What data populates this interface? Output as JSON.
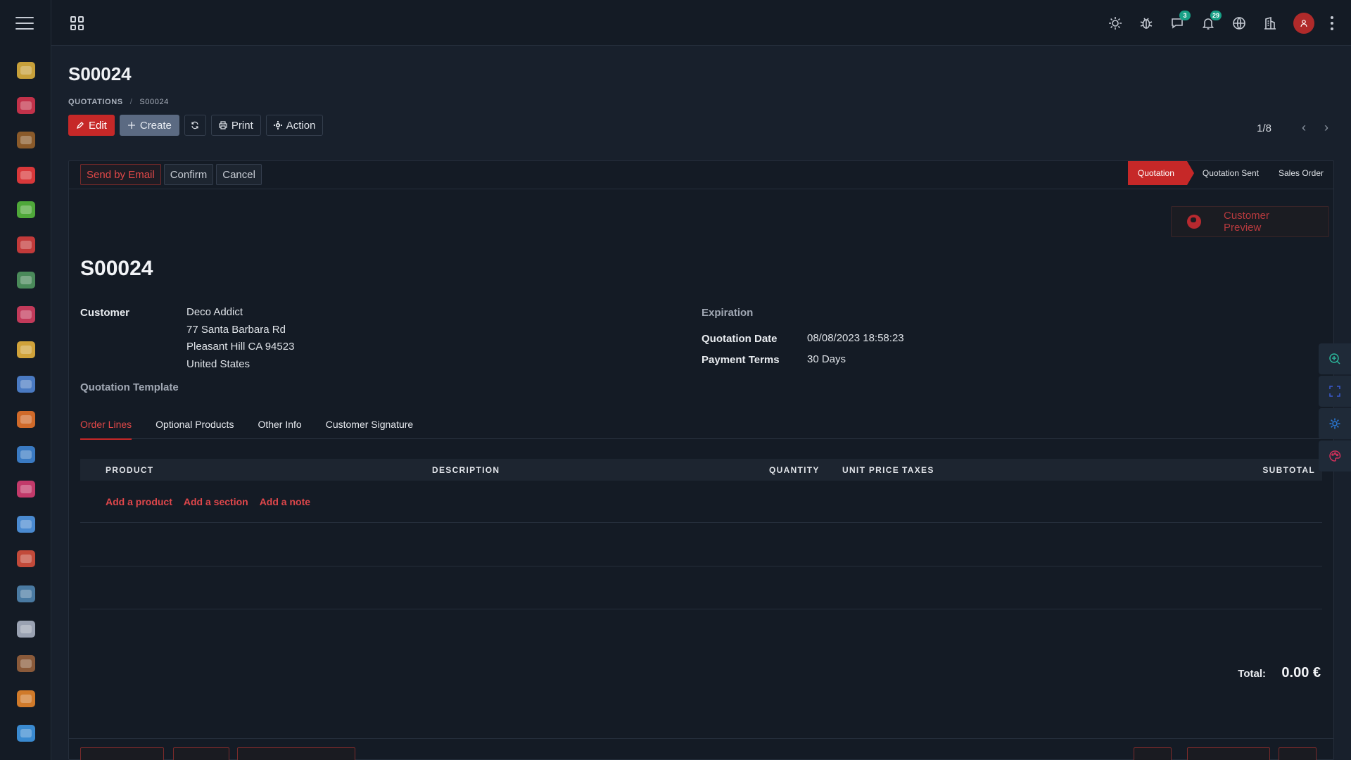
{
  "topbar": {
    "icons": [
      "sun-icon",
      "bug-icon",
      "chat-icon",
      "bell-icon",
      "globe-icon",
      "building-icon",
      "avatar",
      "kebab-icon"
    ],
    "chat_badge": "3",
    "bell_badge": "29"
  },
  "sidebar": {
    "apps": [
      {
        "name": "app-discuss",
        "color": "#c7a03a"
      },
      {
        "name": "app-calendar",
        "color": "#c2324a"
      },
      {
        "name": "app-contacts",
        "color": "#8a5a2a"
      },
      {
        "name": "app-crm",
        "color": "#d8383a"
      },
      {
        "name": "app-sales",
        "color": "#4fa83a"
      },
      {
        "name": "app-dashboards",
        "color": "#c23a3a"
      },
      {
        "name": "app-invoicing",
        "color": "#4a8a5a"
      },
      {
        "name": "app-website",
        "color": "#c23a5a"
      },
      {
        "name": "app-notes",
        "color": "#d0a23a"
      },
      {
        "name": "app-expenses",
        "color": "#4a7ac2"
      },
      {
        "name": "app-purchase",
        "color": "#d06a2a"
      },
      {
        "name": "app-inventory",
        "color": "#3a7ac2"
      },
      {
        "name": "app-events",
        "color": "#c23a6a"
      },
      {
        "name": "app-settings",
        "color": "#4a8ad0"
      },
      {
        "name": "app-employees",
        "color": "#c24a3a"
      },
      {
        "name": "app-fleet",
        "color": "#4a7aa2"
      },
      {
        "name": "app-maintenance",
        "color": "#9aa2b2"
      },
      {
        "name": "app-wallet",
        "color": "#8a5a3a"
      },
      {
        "name": "app-surveys",
        "color": "#d07a2a"
      },
      {
        "name": "app-livechat",
        "color": "#3a8ad0"
      }
    ]
  },
  "control_panel": {
    "title": "S00024",
    "breadcrumb": {
      "parent": "QUOTATIONS",
      "current": "S00024"
    },
    "buttons": {
      "edit": "Edit",
      "create": "Create",
      "print": "Print",
      "action": "Action"
    },
    "pager": "1/8"
  },
  "statusbar": {
    "actions": [
      "Send by Email",
      "Confirm",
      "Cancel"
    ],
    "stages": [
      "Quotation",
      "Quotation Sent",
      "Sales Order"
    ],
    "active_stage": "Quotation"
  },
  "form": {
    "preview_label": "Customer Preview",
    "name": "S00024",
    "customer_label": "Customer",
    "customer_name": "Deco Addict",
    "address_line1": "77 Santa Barbara Rd",
    "address_line2": "Pleasant Hill CA 94523",
    "address_line3": "United States",
    "template_label": "Quotation Template",
    "expiration_label": "Expiration",
    "quotation_date_label": "Quotation Date",
    "quotation_date_value": "08/08/2023 18:58:23",
    "payment_terms_label": "Payment Terms",
    "payment_terms_value": "30 Days"
  },
  "tabs": [
    "Order Lines",
    "Optional Products",
    "Other Info",
    "Customer Signature"
  ],
  "order_lines": {
    "columns": [
      "PRODUCT",
      "DESCRIPTION",
      "QUANTITY",
      "UNIT PRICE",
      "TAXES",
      "SUBTOTAL"
    ],
    "add_product": "Add a product",
    "add_section": "Add a section",
    "add_note": "Add a note",
    "total_label": "Total:",
    "total_value": "0.00 €"
  },
  "colors": {
    "accent": "#c62828",
    "background": "#18202c",
    "badge": "#17a086"
  }
}
